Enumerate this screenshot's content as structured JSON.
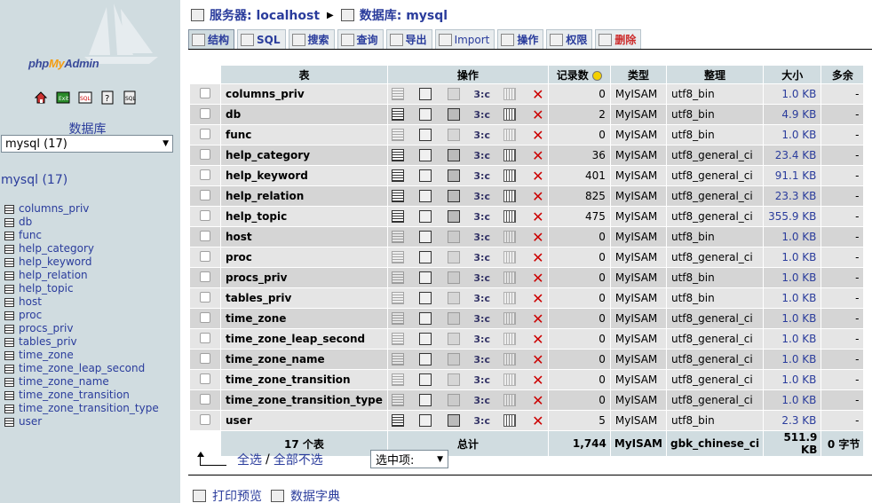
{
  "left": {
    "logo": {
      "php": "php",
      "my": "My",
      "admin": "Admin"
    },
    "icons": [
      "home-icon",
      "exit-icon",
      "sql-icon",
      "help-icon",
      "sql-docs-icon"
    ],
    "db_label": "数据库",
    "db_select_value": "mysql (17)",
    "db_title": "mysql (17)",
    "tables": [
      "columns_priv",
      "db",
      "func",
      "help_category",
      "help_keyword",
      "help_relation",
      "help_topic",
      "host",
      "proc",
      "procs_priv",
      "tables_priv",
      "time_zone",
      "time_zone_leap_second",
      "time_zone_name",
      "time_zone_transition",
      "time_zone_transition_type",
      "user"
    ]
  },
  "breadcrumb": {
    "server": "服务器: localhost",
    "database": "数据库: mysql"
  },
  "tabs": [
    {
      "label": "结构",
      "icon": "structure-icon"
    },
    {
      "label": "SQL",
      "icon": "sql-icon"
    },
    {
      "label": "搜索",
      "icon": "search-icon"
    },
    {
      "label": "查询",
      "icon": "query-icon"
    },
    {
      "label": "导出",
      "icon": "export-icon"
    },
    {
      "label": "Import",
      "icon": "import-icon"
    },
    {
      "label": "操作",
      "icon": "operations-icon"
    },
    {
      "label": "权限",
      "icon": "privileges-icon"
    },
    {
      "label": "删除",
      "icon": "drop-icon"
    }
  ],
  "table": {
    "headers": {
      "table": "表",
      "action": "操作",
      "records": "记录数",
      "type": "类型",
      "collation": "整理",
      "size": "大小",
      "overhead": "多余"
    },
    "rows": [
      {
        "name": "columns_priv",
        "records": "0",
        "type": "MyISAM",
        "collation": "utf8_bin",
        "size": "1.0 KB",
        "overhead": "-"
      },
      {
        "name": "db",
        "records": "2",
        "type": "MyISAM",
        "collation": "utf8_bin",
        "size": "4.9 KB",
        "overhead": "-"
      },
      {
        "name": "func",
        "records": "0",
        "type": "MyISAM",
        "collation": "utf8_bin",
        "size": "1.0 KB",
        "overhead": "-"
      },
      {
        "name": "help_category",
        "records": "36",
        "type": "MyISAM",
        "collation": "utf8_general_ci",
        "size": "23.4 KB",
        "overhead": "-"
      },
      {
        "name": "help_keyword",
        "records": "401",
        "type": "MyISAM",
        "collation": "utf8_general_ci",
        "size": "91.1 KB",
        "overhead": "-"
      },
      {
        "name": "help_relation",
        "records": "825",
        "type": "MyISAM",
        "collation": "utf8_general_ci",
        "size": "23.3 KB",
        "overhead": "-"
      },
      {
        "name": "help_topic",
        "records": "475",
        "type": "MyISAM",
        "collation": "utf8_general_ci",
        "size": "355.9 KB",
        "overhead": "-"
      },
      {
        "name": "host",
        "records": "0",
        "type": "MyISAM",
        "collation": "utf8_bin",
        "size": "1.0 KB",
        "overhead": "-"
      },
      {
        "name": "proc",
        "records": "0",
        "type": "MyISAM",
        "collation": "utf8_general_ci",
        "size": "1.0 KB",
        "overhead": "-"
      },
      {
        "name": "procs_priv",
        "records": "0",
        "type": "MyISAM",
        "collation": "utf8_bin",
        "size": "1.0 KB",
        "overhead": "-"
      },
      {
        "name": "tables_priv",
        "records": "0",
        "type": "MyISAM",
        "collation": "utf8_bin",
        "size": "1.0 KB",
        "overhead": "-"
      },
      {
        "name": "time_zone",
        "records": "0",
        "type": "MyISAM",
        "collation": "utf8_general_ci",
        "size": "1.0 KB",
        "overhead": "-"
      },
      {
        "name": "time_zone_leap_second",
        "records": "0",
        "type": "MyISAM",
        "collation": "utf8_general_ci",
        "size": "1.0 KB",
        "overhead": "-"
      },
      {
        "name": "time_zone_name",
        "records": "0",
        "type": "MyISAM",
        "collation": "utf8_general_ci",
        "size": "1.0 KB",
        "overhead": "-"
      },
      {
        "name": "time_zone_transition",
        "records": "0",
        "type": "MyISAM",
        "collation": "utf8_general_ci",
        "size": "1.0 KB",
        "overhead": "-"
      },
      {
        "name": "time_zone_transition_type",
        "records": "0",
        "type": "MyISAM",
        "collation": "utf8_general_ci",
        "size": "1.0 KB",
        "overhead": "-"
      },
      {
        "name": "user",
        "records": "5",
        "type": "MyISAM",
        "collation": "utf8_bin",
        "size": "2.3 KB",
        "overhead": "-"
      }
    ],
    "footer": {
      "tables": "17 个表",
      "sum": "总计",
      "records": "1,744",
      "type": "MyISAM",
      "collation": "gbk_chinese_ci",
      "size": "511.9 KB",
      "overhead": "0 字节"
    }
  },
  "bulk": {
    "check_all": "全选",
    "slash": "/",
    "uncheck_all": "全部不选",
    "with_selected": "选中项:"
  },
  "bottom": {
    "print_view": "打印预览",
    "data_dictionary": "数据字典"
  },
  "colors": {
    "link": "#2a3c9c",
    "header_bg": "#d0dce0",
    "row_odd": "#e5e5e5",
    "row_even": "#d5d5d5",
    "drop": "#cc0000"
  }
}
